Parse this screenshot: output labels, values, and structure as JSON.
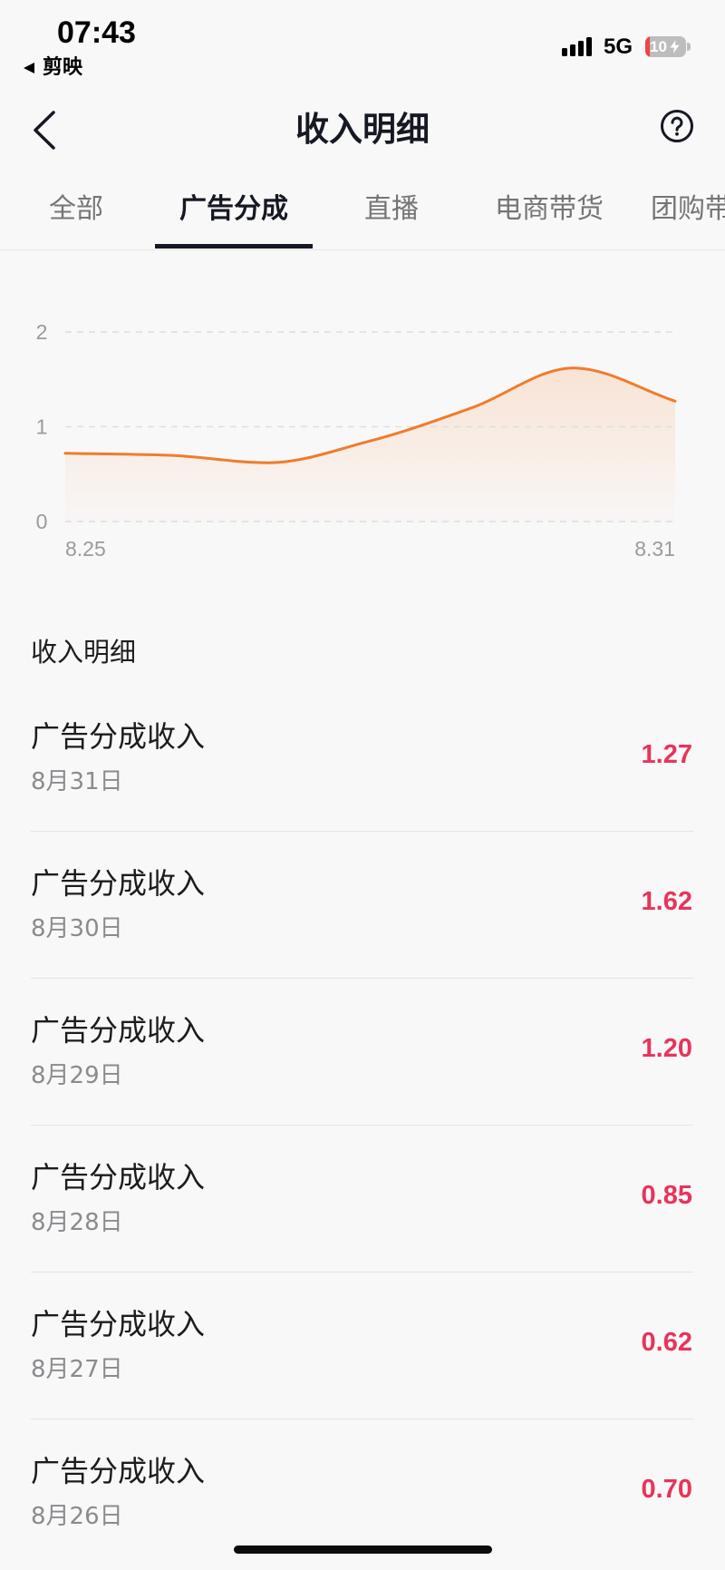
{
  "status_bar": {
    "time": "07:43",
    "back_app": "剪映",
    "network": "5G",
    "battery_text": "10",
    "battery_level": 0.1,
    "signal_icon": "cellular-signal-icon",
    "battery_icon": "battery-charging-icon"
  },
  "header": {
    "back_icon": "chevron-left-icon",
    "title": "收入明细",
    "help_icon": "question-circle-icon"
  },
  "tabs": [
    {
      "label": "全部"
    },
    {
      "label": "广告分成"
    },
    {
      "label": "直播"
    },
    {
      "label": "电商带货"
    },
    {
      "label": "团购带"
    }
  ],
  "colors": {
    "background": "#f8f8f8",
    "text_primary": "#161823",
    "chart_line": "#f07c2c",
    "chart_area": "#f6a56d",
    "amount": "#e8345a",
    "battery_low": "#ee4444"
  },
  "chart_data": {
    "type": "area",
    "x": [
      "8.25",
      "8.26",
      "8.27",
      "8.28",
      "8.29",
      "8.30",
      "8.31"
    ],
    "values": [
      0.72,
      0.7,
      0.62,
      0.85,
      1.2,
      1.62,
      1.27
    ],
    "ylim": [
      0,
      2
    ],
    "y_ticks": [
      0,
      1,
      2
    ],
    "x_ticks": [
      "8.25",
      "8.31"
    ],
    "grid": true
  },
  "detail_section": {
    "title": "收入明细"
  },
  "records": [
    {
      "title": "广告分成收入",
      "date": "8月31日",
      "amount": "1.27"
    },
    {
      "title": "广告分成收入",
      "date": "8月30日",
      "amount": "1.62"
    },
    {
      "title": "广告分成收入",
      "date": "8月29日",
      "amount": "1.20"
    },
    {
      "title": "广告分成收入",
      "date": "8月28日",
      "amount": "0.85"
    },
    {
      "title": "广告分成收入",
      "date": "8月27日",
      "amount": "0.62"
    },
    {
      "title": "广告分成收入",
      "date": "8月26日",
      "amount": "0.70"
    }
  ]
}
